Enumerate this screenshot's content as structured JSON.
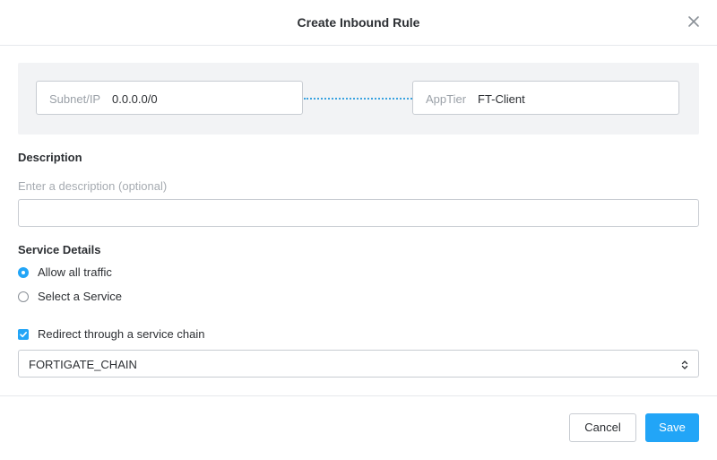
{
  "dialog": {
    "title": "Create Inbound Rule"
  },
  "rule": {
    "source": {
      "label": "Subnet/IP",
      "value": "0.0.0.0/0"
    },
    "destination": {
      "label": "AppTier",
      "value": "FT-Client"
    }
  },
  "description": {
    "heading": "Description",
    "hint": "Enter a description (optional)",
    "value": ""
  },
  "service": {
    "heading": "Service Details",
    "options": [
      {
        "label": "Allow all traffic",
        "selected": true
      },
      {
        "label": "Select a Service",
        "selected": false
      }
    ]
  },
  "service_chain": {
    "checkbox_label": "Redirect through a service chain",
    "checked": true,
    "selected_chain": "FORTIGATE_CHAIN"
  },
  "footer": {
    "cancel_label": "Cancel",
    "save_label": "Save"
  },
  "colors": {
    "accent": "#22a5f7",
    "panel_bg": "#f2f3f5",
    "border": "#c8ccd2",
    "connector": "#3aa3e0"
  },
  "icons": {
    "close": "close-icon",
    "radio": "radio-icon",
    "checkbox": "checkmark-icon",
    "select_caret": "updown-caret-icon"
  }
}
